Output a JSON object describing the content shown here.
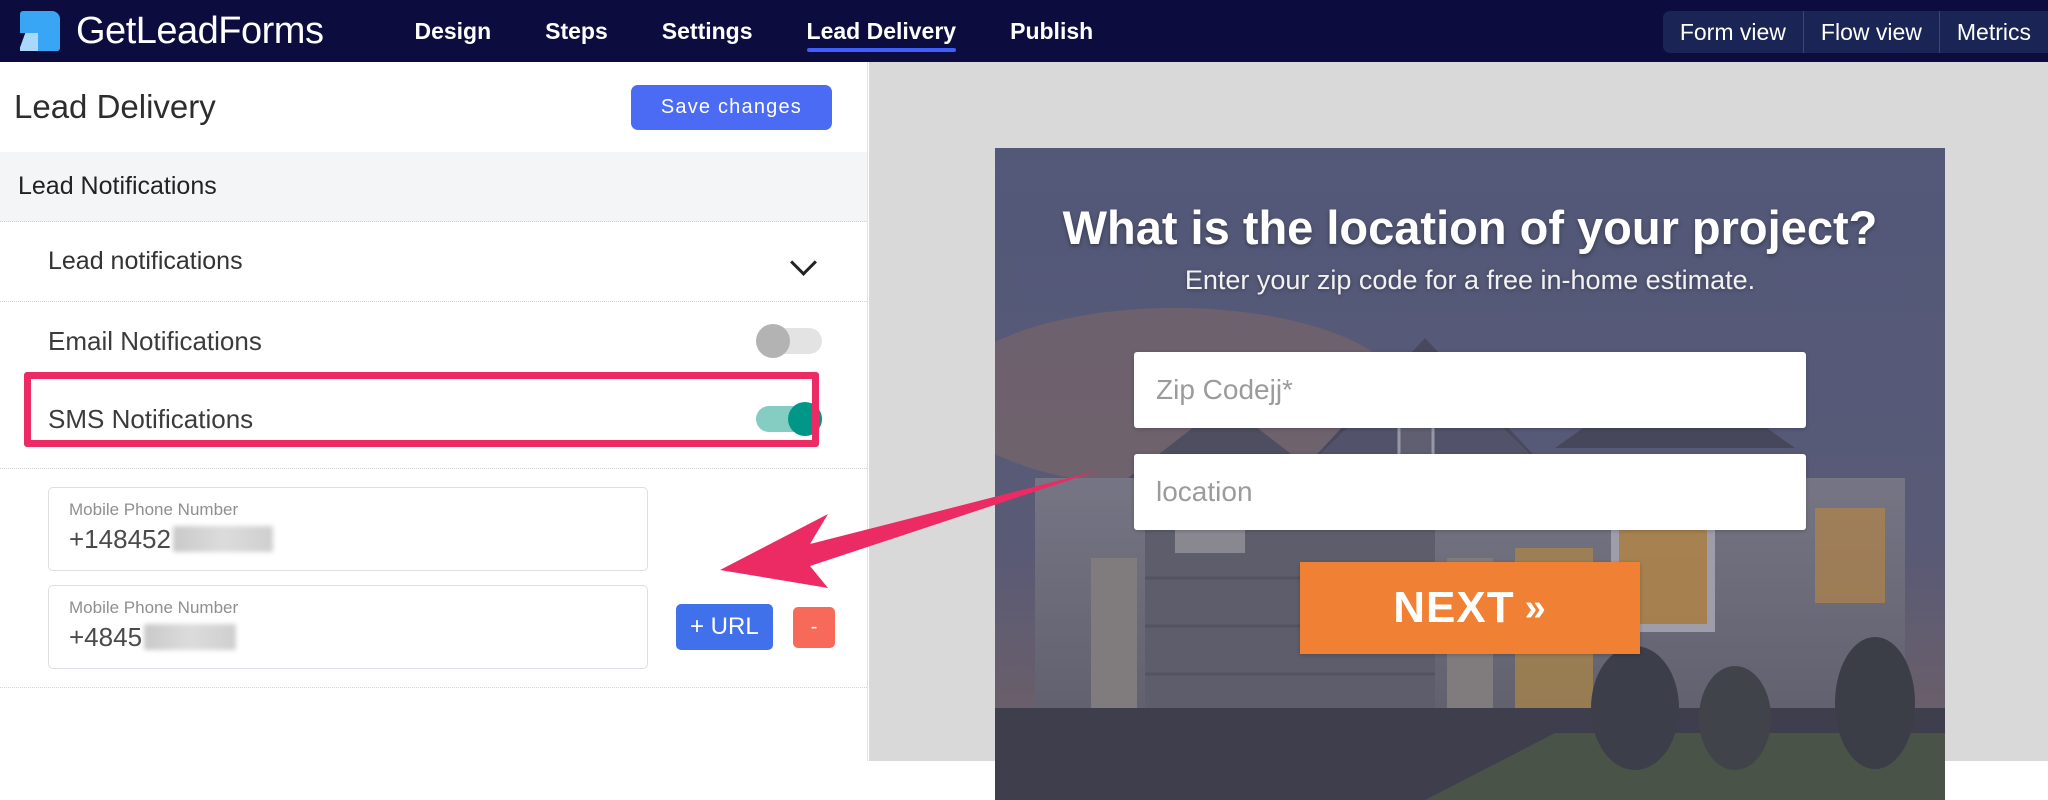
{
  "nav": {
    "brand": "GetLeadForms",
    "logo_icon": "document-logo-icon",
    "links": [
      {
        "label": "Design",
        "active": false
      },
      {
        "label": "Steps",
        "active": false
      },
      {
        "label": "Settings",
        "active": false
      },
      {
        "label": "Lead Delivery",
        "active": true
      },
      {
        "label": "Publish",
        "active": false
      }
    ],
    "views": [
      {
        "label": "Form view"
      },
      {
        "label": "Flow view"
      },
      {
        "label": "Metrics"
      }
    ],
    "bar_color": "#0d0c3e",
    "active_underline_color": "#3f5efb"
  },
  "panel": {
    "title": "Lead Delivery",
    "save_label": "Save changes",
    "save_color": "#4b6bf5",
    "section_header": "Lead Notifications",
    "accordion": {
      "label": "Lead notifications",
      "chevron_icon": "chevron-down-icon"
    },
    "toggles": [
      {
        "label": "Email Notifications",
        "state": "off",
        "off_color": "#b3b3b3"
      },
      {
        "label": "SMS Notifications",
        "state": "on",
        "on_color": "#009688"
      }
    ],
    "highlight_color": "#ec2a63",
    "fields": [
      {
        "caption": "Mobile Phone Number",
        "value": "+148452",
        "redacted": true,
        "has_actions": false
      },
      {
        "caption": "Mobile Phone Number",
        "value": "+4845",
        "redacted": true,
        "has_actions": true
      }
    ],
    "actions": {
      "add_url_label": "+ URL",
      "add_url_color": "#4070ea",
      "remove_label": "-",
      "remove_color": "#f76a5a"
    }
  },
  "annotation": {
    "arrow_color": "#ec2a63",
    "arrow_direction": "points-left-to-phone-field"
  },
  "preview": {
    "title": "What is the location of your project?",
    "subtitle": "Enter your zip code for a free in-home estimate.",
    "inputs": [
      {
        "placeholder": "Zip Codejj*"
      },
      {
        "placeholder": "location"
      }
    ],
    "next_label": "NEXT",
    "next_chevron": "»",
    "next_color": "#f08033",
    "background_image": "suburban-house-at-dusk"
  }
}
